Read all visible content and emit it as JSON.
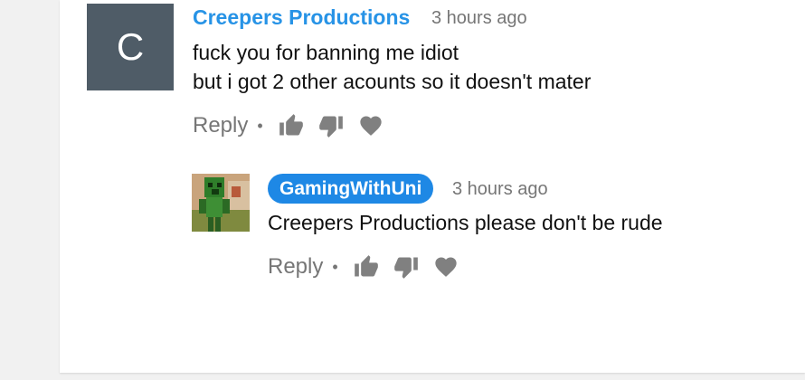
{
  "comment": {
    "avatar_letter": "C",
    "author": "Creepers Productions",
    "time": "3 hours ago",
    "lines": [
      "fuck you for banning me idiot",
      "but i got 2 other acounts so it doesn't mater"
    ],
    "reply_label": "Reply",
    "separator": "•"
  },
  "reply": {
    "author": "GamingWithUni",
    "time": "3 hours ago",
    "text": "Creepers Productions please don't be rude",
    "reply_label": "Reply",
    "separator": "•"
  },
  "colors": {
    "author_link": "#2793e6",
    "badge_bg": "#1e88e5",
    "avatar_bg": "#4f5c67",
    "icon": "#808080"
  },
  "icons": [
    "thumbs-up-icon",
    "thumbs-down-icon",
    "heart-icon"
  ]
}
